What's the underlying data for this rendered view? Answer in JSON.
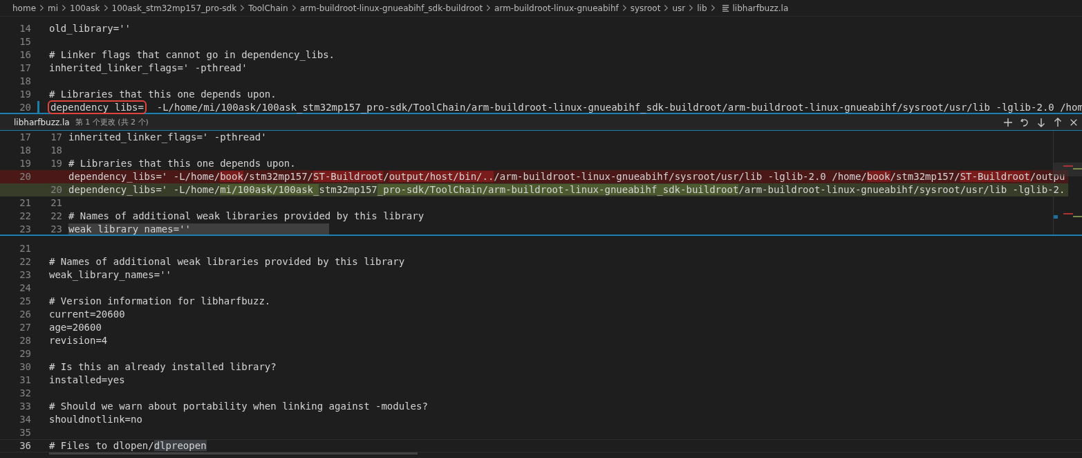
{
  "breadcrumb": {
    "items": [
      "home",
      "mi",
      "100ask",
      "100ask_stm32mp157_pro-sdk",
      "ToolChain",
      "arm-buildroot-linux-gnueabihf_sdk-buildroot",
      "arm-buildroot-linux-gnueabihf",
      "sysroot",
      "usr",
      "lib"
    ],
    "file": "libharfbuzz.la"
  },
  "top_editor": {
    "lines": [
      {
        "number": "14",
        "text": "old_library=''",
        "modified": false
      },
      {
        "number": "15",
        "modified": false
      },
      {
        "number": "16",
        "text": "# Linker flags that cannot go in dependency_libs.",
        "modified": false
      },
      {
        "number": "17",
        "text": "inherited_linker_flags=' -pthread'",
        "modified": false
      },
      {
        "number": "18",
        "modified": false
      },
      {
        "number": "19",
        "text": "# Libraries that this one depends upon.",
        "modified": false
      },
      {
        "number": "20",
        "boxed_text": "dependency_libs=",
        "text": "  -L/home/mi/100ask/100ask_stm32mp157_pro-sdk/ToolChain/arm-buildroot-linux-gnueabihf_sdk-buildroot/arm-buildroot-linux-gnueabihf/sysroot/usr/lib -lglib-2.0 /hom",
        "modified": true
      }
    ]
  },
  "peek": {
    "file": "libharfbuzz.la",
    "summary": "第 1 个更改 (共 2 个)",
    "actions": [
      {
        "kind": "add"
      },
      {
        "kind": "revert"
      },
      {
        "kind": "next"
      },
      {
        "kind": "previous"
      },
      {
        "kind": "close"
      }
    ],
    "lines": [
      {
        "original_number": "17",
        "modified_number": "17",
        "kind": "context",
        "segments": [
          {
            "text": "inherited_linker_flags=' -pthread'",
            "changed": false
          }
        ]
      },
      {
        "original_number": "18",
        "modified_number": "18",
        "kind": "context"
      },
      {
        "original_number": "19",
        "modified_number": "19",
        "kind": "context",
        "segments": [
          {
            "text": "# Libraries that this one depends upon.",
            "changed": false
          }
        ]
      },
      {
        "original_number": "20",
        "kind": "removed",
        "segments": [
          {
            "text": "dependency_libs=' -L/home/",
            "changed": false
          },
          {
            "text": "book",
            "changed": true
          },
          {
            "text": "/stm32mp157/",
            "changed": false
          },
          {
            "text": "ST-Buildroot",
            "changed": true
          },
          {
            "text": "/",
            "changed": false
          },
          {
            "text": "output/host/bin/..",
            "changed": true
          },
          {
            "text": "/arm-buildroot-linux-gnueabihf/sysroot/usr/lib -lglib-2.0 /home/",
            "changed": false
          },
          {
            "text": "book",
            "changed": true
          },
          {
            "text": "/stm32mp157/",
            "changed": false
          },
          {
            "text": "ST-Buildroot",
            "changed": true
          },
          {
            "text": "/outpu",
            "changed": false
          }
        ]
      },
      {
        "modified_number": "20",
        "kind": "added",
        "segments": [
          {
            "text": "dependency_libs=' -L/home/",
            "changed": false
          },
          {
            "text": "mi/100ask/100ask_",
            "changed": true
          },
          {
            "text": "stm32mp157",
            "changed": false
          },
          {
            "text": "_pro-sdk/ToolChain/arm-buildroot",
            "changed": true
          },
          {
            "text": "-linux-gnueabihf_sdk-buildroot",
            "changed": true
          },
          {
            "text": "/arm-buildroot-linux-gnueabihf/sysroot/usr/lib -lglib-2.",
            "changed": false
          }
        ]
      },
      {
        "original_number": "21",
        "modified_number": "21",
        "kind": "context"
      },
      {
        "original_number": "22",
        "modified_number": "22",
        "kind": "context",
        "segments": [
          {
            "text": "# Names of additional weak libraries provided by this library",
            "changed": false
          }
        ]
      },
      {
        "original_number": "23",
        "modified_number": "23",
        "kind": "highlighted",
        "segments": [
          {
            "text": "weak_library_names=''",
            "changed": false
          }
        ]
      }
    ]
  },
  "bottom_editor": {
    "lines": [
      {
        "number": "21",
        "current": false
      },
      {
        "number": "22",
        "text": "# Names of additional weak libraries provided by this library",
        "current": false
      },
      {
        "number": "23",
        "text": "weak_library_names=''",
        "current": false
      },
      {
        "number": "24",
        "current": false
      },
      {
        "number": "25",
        "text": "# Version information for libharfbuzz.",
        "current": false
      },
      {
        "number": "26",
        "text": "current=20600",
        "current": false
      },
      {
        "number": "27",
        "text": "age=20600",
        "current": false
      },
      {
        "number": "28",
        "text": "revision=4",
        "current": false
      },
      {
        "number": "29",
        "current": false
      },
      {
        "number": "30",
        "text": "# Is this an already installed library?",
        "current": false
      },
      {
        "number": "31",
        "text": "installed=yes",
        "current": false
      },
      {
        "number": "32",
        "current": false
      },
      {
        "number": "33",
        "text": "# Should we warn about portability when linking against -modules?",
        "current": false
      },
      {
        "number": "34",
        "text": "shouldnotlink=no",
        "current": false
      },
      {
        "number": "35",
        "current": false
      },
      {
        "number": "36",
        "text": "# Files to dlopen/",
        "highlighted_word": "dlpreopen",
        "current": true
      }
    ]
  }
}
